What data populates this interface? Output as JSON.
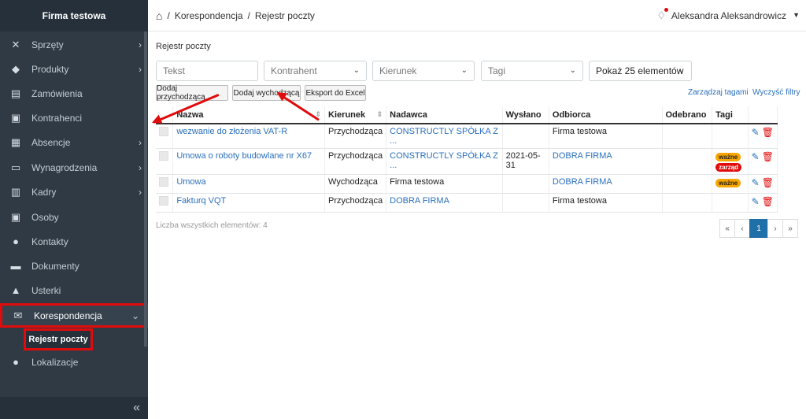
{
  "sidebar": {
    "brand": "Firma testowa",
    "items": [
      {
        "label": "Sprzęty",
        "icon": "tools-icon",
        "glyph": "✕",
        "chevron": true
      },
      {
        "label": "Produkty",
        "icon": "cubes-icon",
        "glyph": "◆",
        "chevron": true
      },
      {
        "label": "Zamówienia",
        "icon": "truck-icon",
        "glyph": "▤",
        "chevron": false
      },
      {
        "label": "Kontrahenci",
        "icon": "contact-book-icon",
        "glyph": "▣",
        "chevron": false
      },
      {
        "label": "Absencje",
        "icon": "calendar-icon",
        "glyph": "▦",
        "chevron": true
      },
      {
        "label": "Wynagrodzenia",
        "icon": "money-icon",
        "glyph": "▭",
        "chevron": true
      },
      {
        "label": "Kadry",
        "icon": "id-card-icon",
        "glyph": "▥",
        "chevron": true
      },
      {
        "label": "Osoby",
        "icon": "person-card-icon",
        "glyph": "▣",
        "chevron": false
      },
      {
        "label": "Kontakty",
        "icon": "users-icon",
        "glyph": "●",
        "chevron": false
      },
      {
        "label": "Dokumenty",
        "icon": "folder-icon",
        "glyph": "▬",
        "chevron": false
      },
      {
        "label": "Usterki",
        "icon": "warning-icon",
        "glyph": "▲",
        "chevron": false
      },
      {
        "label": "Korespondencja",
        "icon": "mail-icon",
        "glyph": "✉",
        "chevron": true
      },
      {
        "label": "Lokalizacje",
        "icon": "map-marker-icon",
        "glyph": "●",
        "chevron": false
      }
    ],
    "subitem": "Rejestr poczty",
    "collapse_glyph": "«"
  },
  "topbar": {
    "home_glyph": "⌂",
    "crumbs": [
      "/",
      "Korespondencja",
      "/",
      "Rejestr poczty"
    ],
    "user": "Aleksandra Aleksandrowicz",
    "bell_glyph": "♢"
  },
  "page": {
    "title": "Rejestr poczty"
  },
  "filters": {
    "text_placeholder": "Tekst",
    "kontrahent": "Kontrahent",
    "kierunek": "Kierunek",
    "tagi": "Tagi",
    "page_size": "Pokaż 25 elementów"
  },
  "buttons": {
    "add_incoming": "Dodaj przychodzącą",
    "add_outgoing": "Dodaj wychodzącą",
    "export": "Eksport do Excel",
    "manage_tags": "Zarządzaj tagami",
    "clear_filters": "Wyczyść filtry"
  },
  "table": {
    "headers": [
      "Nazwa",
      "Kierunek",
      "Nadawca",
      "Wysłano",
      "Odbiorca",
      "Odebrano",
      "Tagi"
    ],
    "rows": [
      {
        "nazwa": "wezwanie do złożenia VAT-R",
        "kierunek": "Przychodząca",
        "nadawca": "CONSTRUCTLY SPÓŁKA Z ...",
        "wyslano": "",
        "odbiorca": "Firma testowa",
        "odbiorca_link": false,
        "odebrano": "",
        "tags": []
      },
      {
        "nazwa": "Umowa o roboty budowlane nr X67",
        "kierunek": "Przychodząca",
        "nadawca": "CONSTRUCTLY SPÓŁKA Z ...",
        "wyslano": "2021-05-31",
        "odbiorca": "DOBRA FIRMA",
        "odbiorca_link": true,
        "odebrano": "",
        "tags": [
          "ważne",
          "zarząd"
        ]
      },
      {
        "nazwa": "Umowa",
        "kierunek": "Wychodząca",
        "nadawca": "Firma testowa",
        "wyslano": "",
        "odbiorca": "DOBRA FIRMA",
        "odbiorca_link": true,
        "odebrano": "",
        "tags": [
          "ważne"
        ]
      },
      {
        "nazwa": "Fakturq VQT",
        "kierunek": "Przychodząca",
        "nadawca": "DOBRA FIRMA",
        "wyslano": "",
        "odbiorca": "Firma testowa",
        "odbiorca_link": false,
        "odebrano": "",
        "tags": []
      }
    ]
  },
  "footer": {
    "count": "Liczba wszystkich elementów: 4",
    "pager": [
      "«",
      "‹",
      "1",
      "›",
      "»"
    ]
  },
  "colors": {
    "accent": "#2a6fbd",
    "highlight": "#e10b0b",
    "sidebar": "#2f3a45"
  }
}
